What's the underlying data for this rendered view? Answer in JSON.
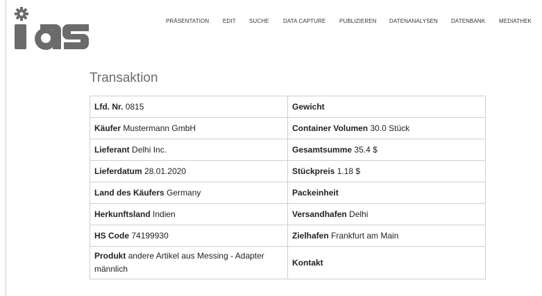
{
  "brand": {
    "logo_text": "ias"
  },
  "nav": [
    {
      "label": "PRÄSENTATION"
    },
    {
      "label": "EDIT"
    },
    {
      "label": "SUCHE"
    },
    {
      "label": "DATA CAPTURE"
    },
    {
      "label": "PUBLIZIEREN"
    },
    {
      "label": "DATENANALYSEN"
    },
    {
      "label": "DATENBANK"
    },
    {
      "label": "MEDIATHEK"
    }
  ],
  "page": {
    "title": "Transaktion"
  },
  "fields": [
    [
      {
        "label": "Lfd. Nr.",
        "value": "0815"
      },
      {
        "label": "Gewicht",
        "value": ""
      }
    ],
    [
      {
        "label": "Käufer",
        "value": "Mustermann GmbH"
      },
      {
        "label": "Container Volumen",
        "value": "30.0 Stück"
      }
    ],
    [
      {
        "label": "Lieferant",
        "value": "Delhi Inc."
      },
      {
        "label": "Gesamtsumme",
        "value": "35.4 $"
      }
    ],
    [
      {
        "label": "Lieferdatum",
        "value": "28.01.2020"
      },
      {
        "label": "Stückpreis",
        "value": "1.18 $"
      }
    ],
    [
      {
        "label": "Land des Käufers",
        "value": "Germany"
      },
      {
        "label": "Packeinheit",
        "value": ""
      }
    ],
    [
      {
        "label": "Herkunftsland",
        "value": "Indien"
      },
      {
        "label": "Versandhafen",
        "value": "Delhi"
      }
    ],
    [
      {
        "label": "HS Code",
        "value": "74199930"
      },
      {
        "label": "Zielhafen",
        "value": "Frankfurt am Main"
      }
    ],
    [
      {
        "label": "Produkt",
        "value": "andere Artikel aus Messing - Adapter männlich"
      },
      {
        "label": "Kontakt",
        "value": ""
      }
    ]
  ],
  "colors": {
    "logo": "#6b6b6b",
    "title": "#6b6b6b",
    "border": "#cfcfcf"
  }
}
